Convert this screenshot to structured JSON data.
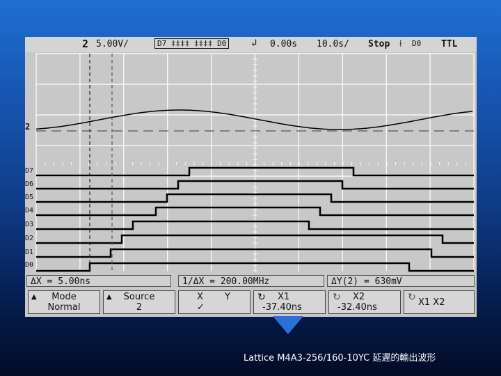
{
  "status": {
    "channel": "2",
    "volts_div": "5.00V/",
    "digital_mask": "D7 ‡‡‡‡ ‡‡‡‡ D0",
    "time_pos": "0.00s",
    "time_div": "10.0s/",
    "run_state": "Stop",
    "trigger_source": "D0",
    "trigger_type": "TTL"
  },
  "markers": {
    "analog": "2",
    "digital": [
      "D7",
      "D6",
      "D5",
      "D4",
      "D3",
      "D2",
      "D1",
      "D0"
    ]
  },
  "measurements": {
    "delta_x": "ΔX = 5.00ns",
    "inv_delta_x": "1/ΔX = 200.00MHz",
    "delta_y": "ΔY(2) = 630mV"
  },
  "softkeys": {
    "mode_label": "Mode",
    "mode_value": "Normal",
    "source_label": "Source",
    "source_value": "2",
    "xy_x": "X",
    "xy_y": "Y",
    "xy_check": "✓",
    "x1_label": "X1",
    "x1_value": "-37.40ns",
    "x2_label": "X2",
    "x2_value": "-32.40ns",
    "x1x2": "X1 X2"
  },
  "caption": "Lattice M4A3-256/160-10YC 延遲的輸出波形",
  "colors": {
    "screen": "#c8c8c8",
    "grid_major": "#ffffff",
    "trace": "#000000",
    "background_top": "#1f6fd1",
    "background_bottom": "#020b26",
    "pointer": "#2c6fd6"
  }
}
